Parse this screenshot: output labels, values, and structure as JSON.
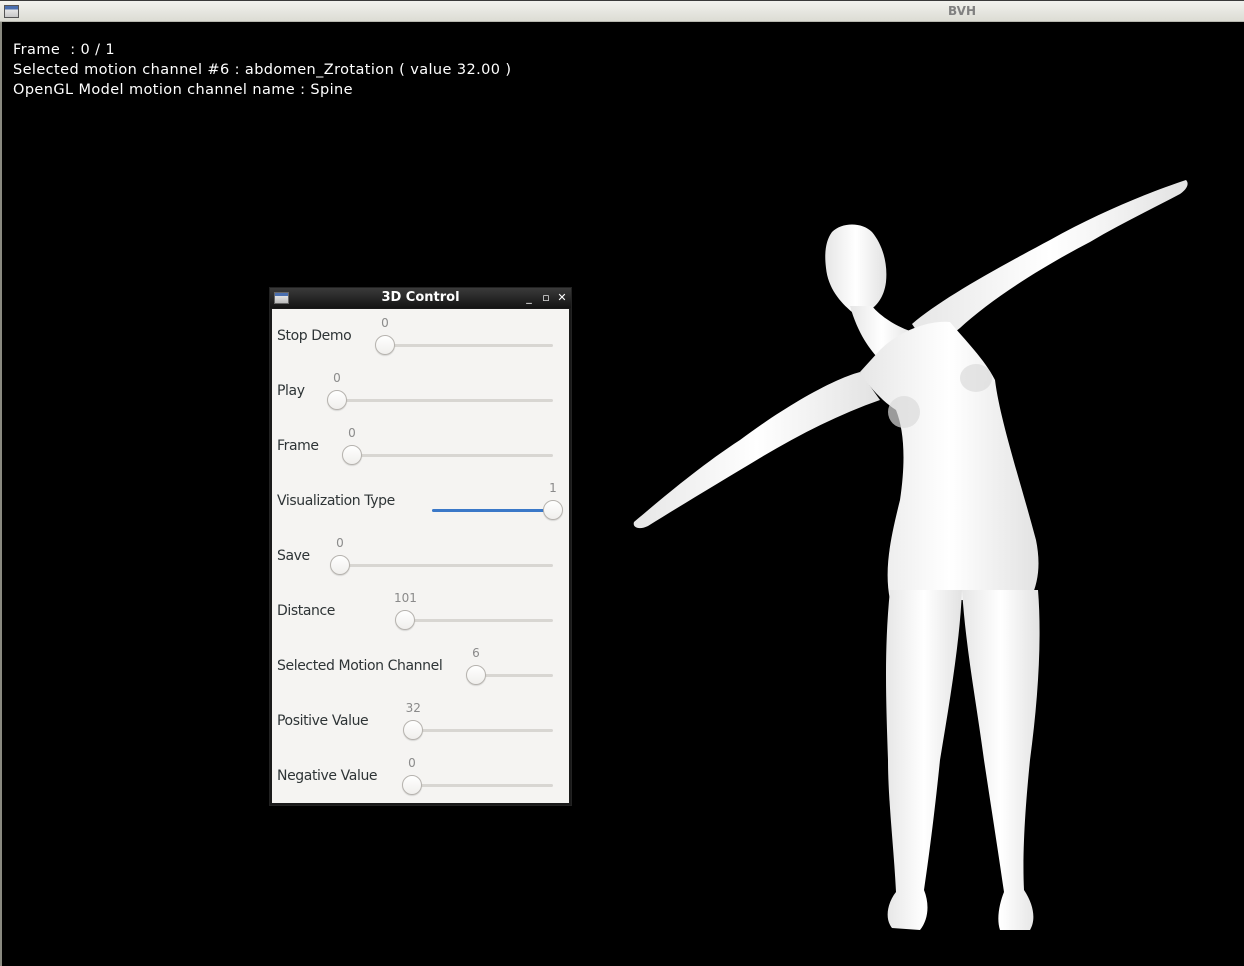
{
  "main_window": {
    "title": "BVH",
    "icon": "window-icon"
  },
  "overlay": {
    "frame_line": "Frame  : 0 / 1",
    "channel_line": "Selected motion channel #6 : abdomen_Zrotation ( value 32.00 )",
    "model_line": "OpenGL Model motion channel name : Spine"
  },
  "scene": {
    "model": "3D human figure (white shaded mesh), arms outstretched, torso rotated",
    "background_color": "#000000",
    "model_color": "#f4f4f4"
  },
  "control_window": {
    "title": "3D Control",
    "icon": "window-icon",
    "buttons": {
      "minimize": "_",
      "maximize": "▫",
      "close": "✕"
    },
    "sliders": [
      {
        "label": "Stop Demo",
        "value": "0",
        "fraction": 0.0
      },
      {
        "label": "Play",
        "value": "0",
        "fraction": 0.0
      },
      {
        "label": "Frame",
        "value": "0",
        "fraction": 0.0
      },
      {
        "label": "Visualization Type",
        "value": "1",
        "fraction": 1.0
      },
      {
        "label": "Save",
        "value": "0",
        "fraction": 0.0
      },
      {
        "label": "Distance",
        "value": "101",
        "fraction": 0.01
      },
      {
        "label": "Selected Motion Channel",
        "value": "6",
        "fraction": 0.0
      },
      {
        "label": "Positive Value",
        "value": "32",
        "fraction": 0.03
      },
      {
        "label": "Negative Value",
        "value": "0",
        "fraction": 0.0
      }
    ],
    "accent_color": "#3a78c8"
  }
}
